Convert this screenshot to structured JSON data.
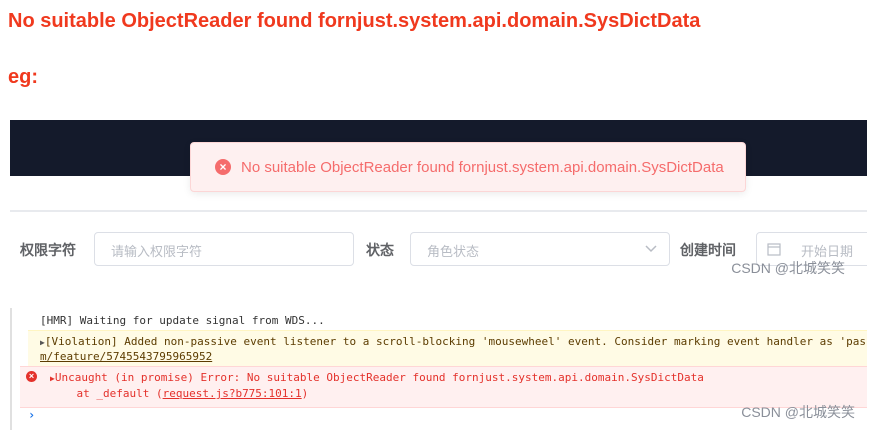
{
  "heading": "No suitable ObjectReader found fornjust.system.api.domain.SysDictData",
  "eg_label": "eg:",
  "ui": {
    "toast": {
      "icon": "error-circle-icon",
      "message": "No suitable ObjectReader found fornjust.system.api.domain.SysDictData"
    },
    "filters": {
      "permission_label": "权限字符",
      "permission_placeholder": "请输入权限字符",
      "status_label": "状态",
      "status_placeholder": "角色状态",
      "created_label": "创建时间",
      "start_date_placeholder": "开始日期"
    },
    "watermark": "CSDN @北城笑笑"
  },
  "console": {
    "hmr_line": "[HMR] Waiting for update signal from WDS...",
    "violation_line1": "[Violation] Added non-passive event listener to a scroll-blocking 'mousewheel' event. Consider marking event handler as 'pas",
    "violation_line2": "m/feature/5745543795965952",
    "error_line1": "Uncaught (in promise) Error: No suitable ObjectReader found fornjust.system.api.domain.SysDictData",
    "error_line2_prefix": "    at _default (",
    "error_line2_link": "request.js?b775:101:1",
    "error_line2_suffix": ")",
    "prompt": "›"
  },
  "watermark": "CSDN @北城笑笑",
  "colors": {
    "heading": "#f0391e",
    "toast_bg": "#fef0f0",
    "toast_text": "#f56c6c",
    "topbar": "#141a2b",
    "console_error": "#e4312b",
    "console_warn_bg": "#fffbe5"
  }
}
